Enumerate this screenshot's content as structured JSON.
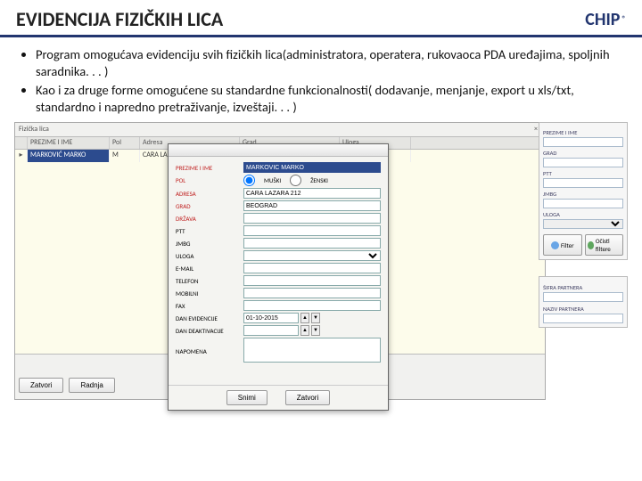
{
  "header": {
    "title": "EVIDENCIJA FIZIČKIH LICA",
    "logo_text": "CHIP",
    "logo_reg": "®"
  },
  "bullets": {
    "b1": "Program omogućava evidenciju svih fizičkih lica(administratora, operatera, rukovaoca PDA uređajima, spoljnih saradnika. . . )",
    "b2": "Kao i za druge forme omogućene su standardne funkcionalnosti( dodavanje, menjanje, export u xls/txt, standardno i napredno pretraživanje, izveštaji. . . )"
  },
  "main_window": {
    "title": "Fizička lica",
    "close": "×",
    "columns": {
      "c1": "PREZIME I IME",
      "c2": "Pol",
      "c3": "Adresa",
      "c4": "Grad",
      "c5": "Uloga"
    },
    "row": {
      "marker": "▸",
      "name": "MARKOVIĆ MARKO",
      "pol": "M",
      "adresa": "CARA LAZARA 212",
      "grad": "BEOGRAD",
      "uloga": ""
    },
    "footer": {
      "zatvori": "Zatvori",
      "radnja": "Radnja"
    }
  },
  "filter": {
    "labels": {
      "prezime": "PREZIME I IME",
      "grad": "GRAD",
      "ptt": "PTT",
      "jmbg": "JMBG",
      "uloga": "ULOGA"
    },
    "values": {
      "prezime": "",
      "grad": "",
      "ptt": "",
      "jmbg": "",
      "uloga": ""
    },
    "buttons": {
      "filter": "Filter",
      "ocisti": "Očisti filtere"
    }
  },
  "extra": {
    "labels": {
      "sifra": "ŠIFRA PARTNERA",
      "naziv": "NAZIV PARTNERA"
    },
    "values": {
      "sifra": "",
      "naziv": ""
    }
  },
  "dialog": {
    "fields": {
      "prezime": {
        "label": "PREZIME I IME",
        "value": "MARKOVIĆ MARKO"
      },
      "pol": {
        "label": "POL",
        "opt_m": "MUŠKI",
        "opt_z": "ŽENSKI"
      },
      "adresa": {
        "label": "ADRESA",
        "value": "CARA LAZARA 212"
      },
      "grad": {
        "label": "GRAD",
        "value": "BEOGRAD"
      },
      "drzava": {
        "label": "DRŽAVA",
        "value": ""
      },
      "ptt": {
        "label": "PTT",
        "value": ""
      },
      "jmbg": {
        "label": "JMBG",
        "value": ""
      },
      "uloga": {
        "label": "ULOGA",
        "value": ""
      },
      "email": {
        "label": "E-MAIL",
        "value": ""
      },
      "telefon": {
        "label": "TELEFON",
        "value": ""
      },
      "mobilni": {
        "label": "MOBILNI",
        "value": ""
      },
      "fax": {
        "label": "FAX",
        "value": ""
      },
      "dan": {
        "label": "DAN EVIDENCIJE",
        "value": "01-10-2015"
      },
      "deakt": {
        "label": "DAN DEAKTIVACIJE",
        "value": ""
      },
      "napom": {
        "label": "NAPOMENA",
        "value": ""
      }
    },
    "buttons": {
      "snimi": "Snimi",
      "zatvori": "Zatvori"
    }
  }
}
